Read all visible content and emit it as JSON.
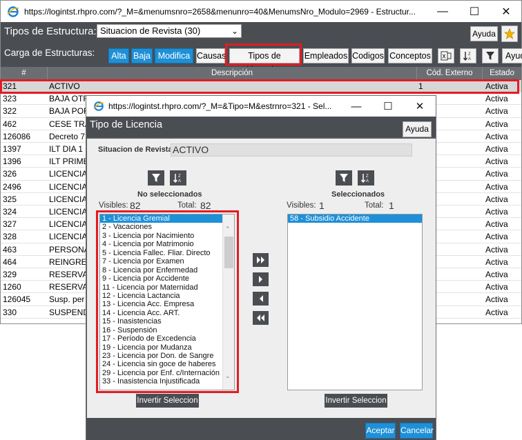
{
  "main_window": {
    "title": "https://logintst.rhpro.com/?_M=&menumsnro=2658&menunro=40&MenumsNro_Modulo=2969 - Estructur...",
    "tipos_label": "Tipos de Estructura:",
    "tipos_selected": "Situacion de Revista (30)",
    "ayuda_label": "Ayuda",
    "carga_label": "Carga de Estructuras:",
    "buttons": {
      "alta": "Alta",
      "baja": "Baja",
      "modifica": "Modifica",
      "causas": "Causas",
      "tipos_licencias": "Tipos de Licencias",
      "empleados": "Empleados",
      "codigos": "Codigos",
      "conceptos": "Conceptos",
      "ayuda_cut": "Ayud"
    },
    "grid": {
      "headers": [
        "#",
        "Descripción",
        "Cód. Externo",
        "Estado"
      ],
      "rows": [
        {
          "id": "321",
          "desc": "ACTIVO",
          "ext": "1",
          "estado": "Activa"
        },
        {
          "id": "323",
          "desc": "BAJA OTR",
          "ext": "",
          "estado": "Activa"
        },
        {
          "id": "322",
          "desc": "BAJA POR",
          "ext": "",
          "estado": "Activa"
        },
        {
          "id": "462",
          "desc": "CESE TRA",
          "ext": "",
          "estado": "Activa"
        },
        {
          "id": "126086",
          "desc": "Decreto 7",
          "ext": "",
          "estado": "Activa"
        },
        {
          "id": "1397",
          "desc": "ILT DIA 1",
          "ext": "",
          "estado": "Activa"
        },
        {
          "id": "1396",
          "desc": "ILT PRIME",
          "ext": "",
          "estado": "Activa"
        },
        {
          "id": "326",
          "desc": "LICENCIA",
          "ext": "",
          "estado": "Activa"
        },
        {
          "id": "2496",
          "desc": "LICENCIA",
          "ext": "",
          "estado": "Activa"
        },
        {
          "id": "325",
          "desc": "LICENCIA",
          "ext": "",
          "estado": "Activa"
        },
        {
          "id": "324",
          "desc": "LICENCIA",
          "ext": "",
          "estado": "Activa"
        },
        {
          "id": "327",
          "desc": "LICENCIA",
          "ext": "",
          "estado": "Activa"
        },
        {
          "id": "328",
          "desc": "LICENCIA",
          "ext": "",
          "estado": "Activa"
        },
        {
          "id": "463",
          "desc": "PERSONA",
          "ext": "",
          "estado": "Activa"
        },
        {
          "id": "464",
          "desc": "REINGRES",
          "ext": "",
          "estado": "Activa"
        },
        {
          "id": "329",
          "desc": "RESERVA",
          "ext": "",
          "estado": "Activa"
        },
        {
          "id": "1260",
          "desc": "RESERVA",
          "ext": "",
          "estado": "Activa"
        },
        {
          "id": "126045",
          "desc": "Susp. per",
          "ext": "",
          "estado": "Activa"
        },
        {
          "id": "330",
          "desc": "SUSPEND",
          "ext": "",
          "estado": "Activa"
        }
      ]
    }
  },
  "dialog": {
    "title": "https://logintst.rhpro.com/?_M=&Tipo=M&estrnro=321 - Sel...",
    "header": "Tipo de Licencia",
    "ayuda_label": "Ayuda",
    "sit_revista_label": "Situacion de Revista:",
    "sit_revista_value": "ACTIVO",
    "left": {
      "title": "No seleccionados",
      "visibles_label": "Visibles:",
      "visibles_value": "82",
      "total_label": "Total:",
      "total_value": "82",
      "items": [
        "1 - Licencia Gremial",
        "2 - Vacaciones",
        "3 - Licencia por Nacimiento",
        "4 - Licencia por Matrimonio",
        "5 - Licencia Fallec. Fliar. Directo",
        "7 - Licencia por Examen",
        "8 - Licencia por Enfermedad",
        "9 - Licencia por Accidente",
        "11 - Licencia por Maternidad",
        "12 - Licencia  Lactancia",
        "13 - Licencia Acc. Empresa",
        "14 - Licencia Acc. ART.",
        "15 - Inasistencias",
        "16 - Suspensión",
        "17 - Período de Excedencia",
        "19 - Licencia por Mudanza",
        "23 - Licencia por Don. de Sangre",
        "24 - Licencia sin goce de haberes",
        "29 - Licencia por Enf. c/Internación",
        "33 - Inasistencia Injustificada"
      ],
      "invert_label": "Invertir Seleccion"
    },
    "right": {
      "title": "Seleccionados",
      "visibles_label": "Visibles:",
      "visibles_value": "1",
      "total_label": "Total:",
      "total_value": "1",
      "items": [
        "58 - Subsidio Accidente"
      ],
      "invert_label": "Invertir Seleccion"
    },
    "aceptar_label": "Aceptar",
    "cancelar_label": "Cancelar"
  },
  "colors": {
    "toolbar_dark": "#4a4d52",
    "accent_blue": "#1e90d8",
    "highlight_red": "#e31b23"
  },
  "icons": [
    "ie-icon",
    "minimize-icon",
    "maximize-icon",
    "close-icon",
    "star-icon",
    "excel-icon",
    "sort-za-icon",
    "filter-icon",
    "chevron-down-icon",
    "move-all-right-icon",
    "move-right-icon",
    "move-left-icon",
    "move-all-left-icon"
  ]
}
